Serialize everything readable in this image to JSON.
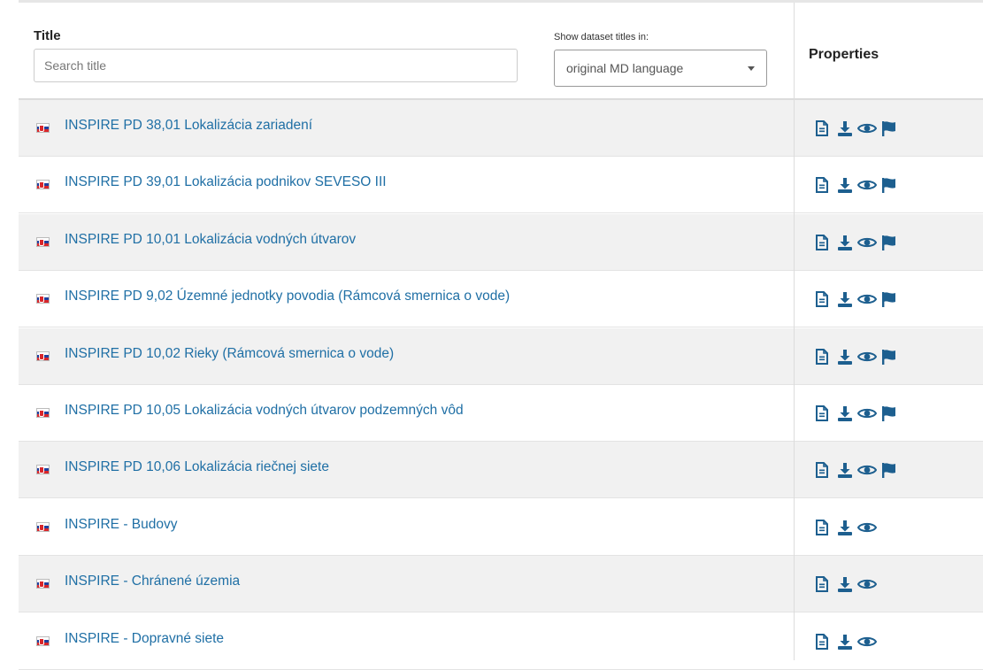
{
  "header": {
    "title_label": "Title",
    "search_placeholder": "Search title",
    "lang_label": "Show dataset titles in:",
    "lang_selected": "original MD language",
    "properties_label": "Properties"
  },
  "colors": {
    "link": "#1f6fa5",
    "icon": "#1d5f8f",
    "row_alt": "#f1f1f1"
  },
  "rows": [
    {
      "title": "INSPIRE PD 38,01 Lokalizácia zariadení",
      "icons": [
        "document-icon",
        "download-icon",
        "eye-icon",
        "flag-icon"
      ]
    },
    {
      "title": "INSPIRE PD 39,01 Lokalizácia podnikov SEVESO III",
      "icons": [
        "document-icon",
        "download-icon",
        "eye-icon",
        "flag-icon"
      ]
    },
    {
      "title": "INSPIRE PD 10,01 Lokalizácia vodných útvarov",
      "icons": [
        "document-icon",
        "download-icon",
        "eye-icon",
        "flag-icon"
      ]
    },
    {
      "title": "INSPIRE PD 9,02 Územné jednotky povodia (Rámcová smernica o vode)",
      "icons": [
        "document-icon",
        "download-icon",
        "eye-icon",
        "flag-icon"
      ]
    },
    {
      "title": "INSPIRE PD 10,02 Rieky (Rámcová smernica o vode)",
      "icons": [
        "document-icon",
        "download-icon",
        "eye-icon",
        "flag-icon"
      ]
    },
    {
      "title": "INSPIRE PD 10,05 Lokalizácia vodných útvarov podzemných vôd",
      "icons": [
        "document-icon",
        "download-icon",
        "eye-icon",
        "flag-icon"
      ]
    },
    {
      "title": "INSPIRE PD 10,06 Lokalizácia riečnej siete",
      "icons": [
        "document-icon",
        "download-icon",
        "eye-icon",
        "flag-icon"
      ]
    },
    {
      "title": "INSPIRE - Budovy",
      "icons": [
        "document-icon",
        "download-icon",
        "eye-icon"
      ]
    },
    {
      "title": "INSPIRE - Chránené územia",
      "icons": [
        "document-icon",
        "download-icon",
        "eye-icon"
      ]
    },
    {
      "title": "INSPIRE - Dopravné siete",
      "icons": [
        "document-icon",
        "download-icon",
        "eye-icon"
      ]
    }
  ]
}
